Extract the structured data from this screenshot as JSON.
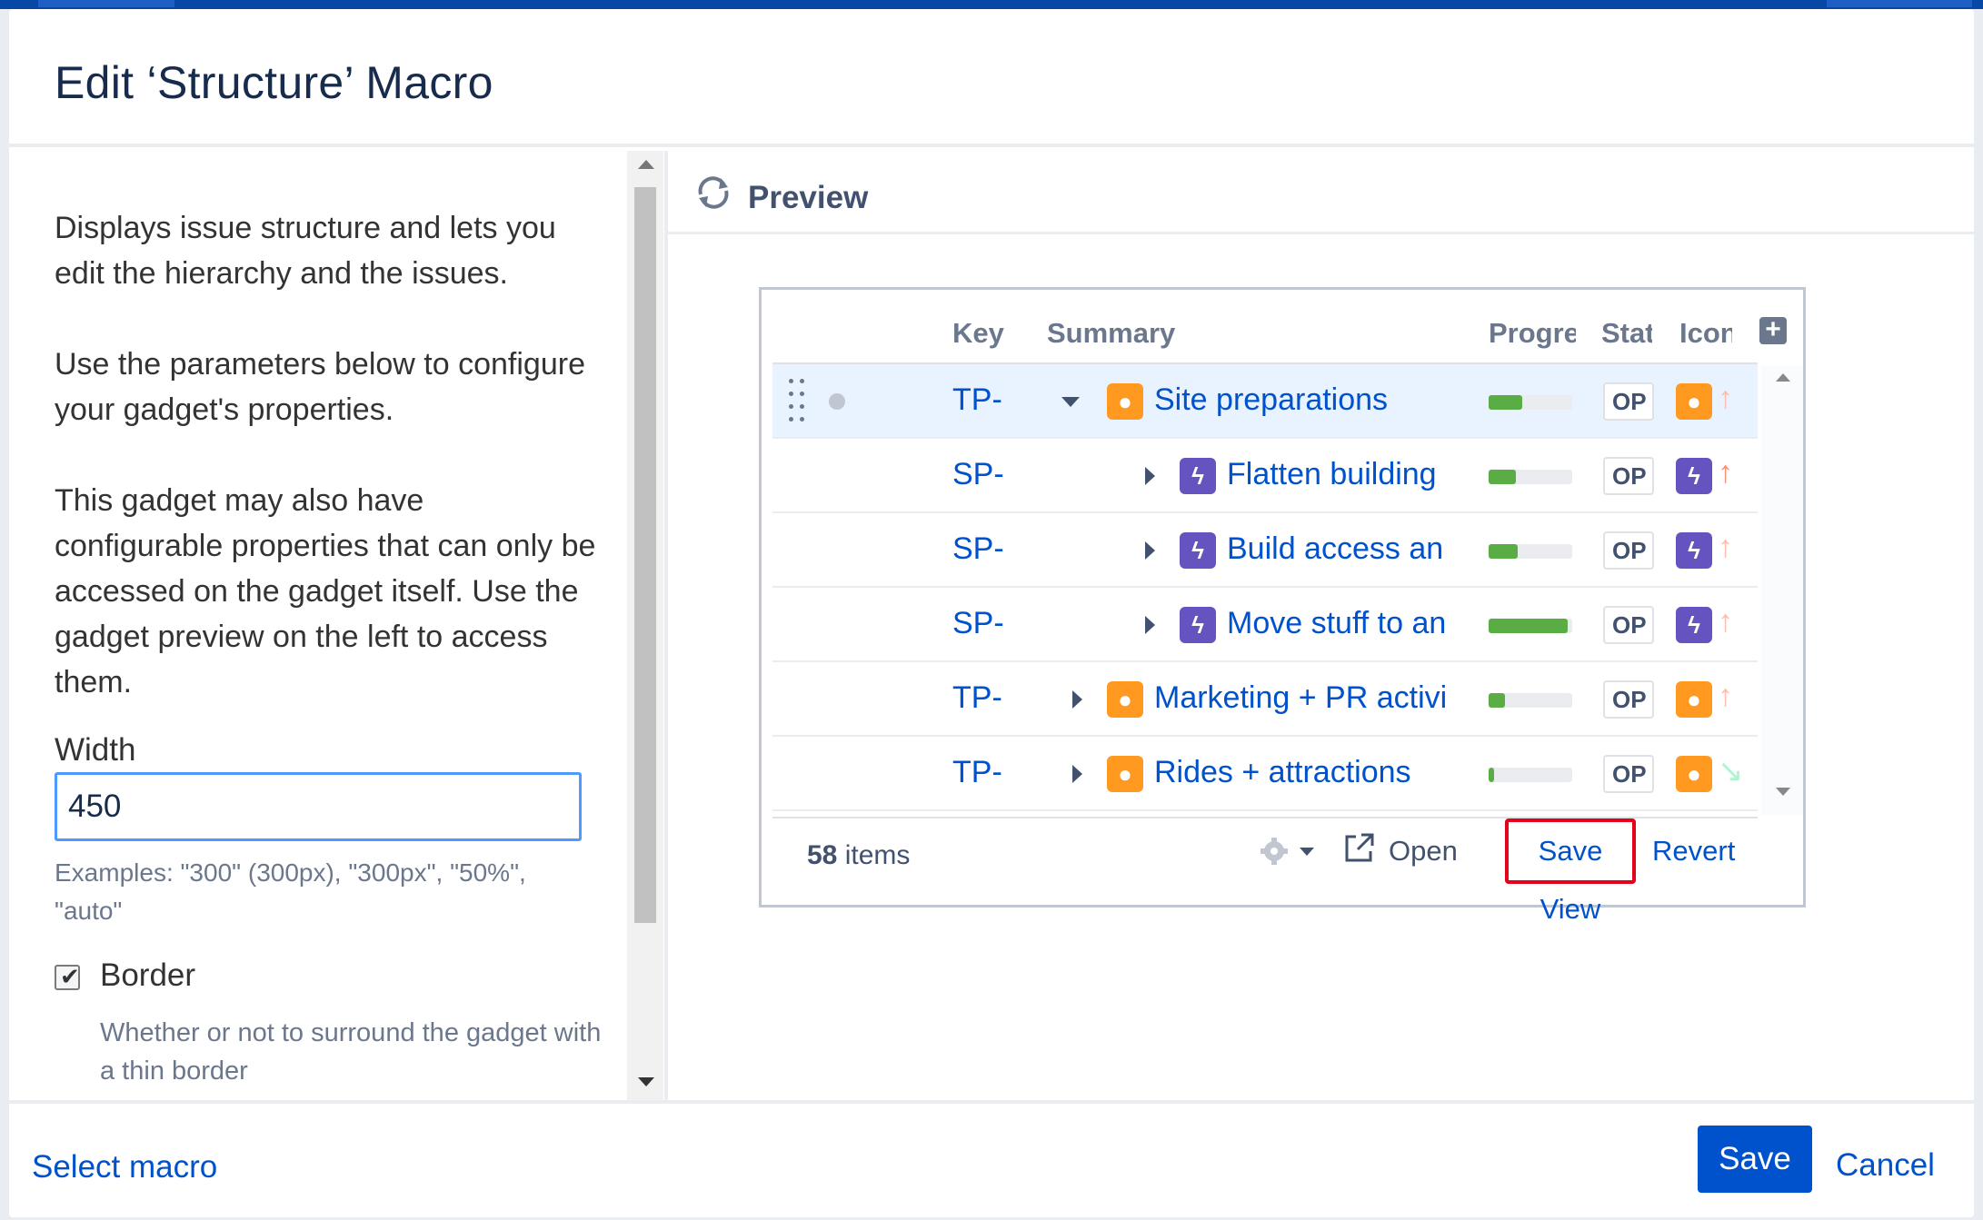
{
  "dialog": {
    "title": "Edit ‘Structure’ Macro"
  },
  "left_panel": {
    "paragraphs": [
      "Displays issue structure and lets you edit the hierarchy and the issues.",
      "Use the parameters below to configure your gadget's properties.",
      "This gadget may also have configurable properties that can only be accessed on the gadget itself. Use the gadget preview on the left to access them."
    ],
    "width_label": "Width",
    "width_value": "450",
    "width_examples": "Examples: \"300\" (300px), \"300px\", \"50%\", \"auto\"",
    "border_label": "Border",
    "border_checked": true,
    "border_desc": "Whether or not to surround the gadget with a thin border"
  },
  "preview": {
    "title": "Preview",
    "columns": [
      "Key",
      "Summary",
      "Progre",
      "Stat",
      "Icon"
    ],
    "rows": [
      {
        "key": "TP-",
        "summary": "Site preparations",
        "type": "idea",
        "expanded": true,
        "progress": 0.4,
        "status": "OP",
        "arrow": "↑"
      },
      {
        "key": "SP-",
        "summary": "Flatten building",
        "type": "epic",
        "expanded": false,
        "progress": 0.33,
        "status": "OP",
        "arrow": "↑"
      },
      {
        "key": "SP-",
        "summary": "Build access an",
        "type": "epic",
        "expanded": false,
        "progress": 0.35,
        "status": "OP",
        "arrow": "↑"
      },
      {
        "key": "SP-",
        "summary": "Move stuff to an",
        "type": "epic",
        "expanded": false,
        "progress": 0.95,
        "status": "OP",
        "arrow": "↑"
      },
      {
        "key": "TP-",
        "summary": "Marketing + PR activi",
        "type": "idea",
        "expanded": false,
        "progress": 0.2,
        "status": "OP",
        "arrow": "↑"
      },
      {
        "key": "TP-",
        "summary": "Rides + attractions",
        "type": "idea",
        "expanded": false,
        "progress": 0.06,
        "status": "OP",
        "arrow": "↘"
      }
    ],
    "items_count": "58",
    "items_label": "items",
    "open_label": "Open",
    "save_view_label": "Save View",
    "revert_label": "Revert"
  },
  "footer": {
    "select_macro": "Select macro",
    "save": "Save",
    "cancel": "Cancel"
  },
  "colors": {
    "primary": "#0052cc",
    "idea": "#ff991f",
    "epic": "#6554c0",
    "progress": "#5aac44",
    "highlight": "#e5001c"
  }
}
